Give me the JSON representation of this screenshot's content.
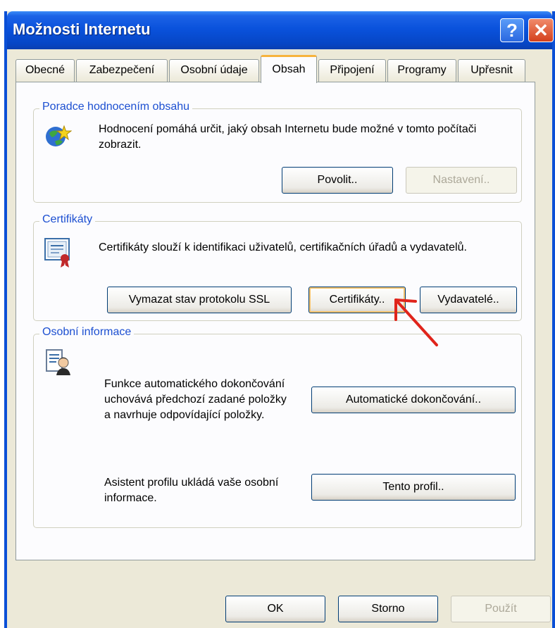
{
  "window": {
    "title": "Možnosti Internetu",
    "help_glyph": "?",
    "close_glyph": "✕"
  },
  "tabs": [
    {
      "label": "Obecné"
    },
    {
      "label": "Zabezpečení"
    },
    {
      "label": "Osobní údaje"
    },
    {
      "label": "Obsah",
      "active": true
    },
    {
      "label": "Připojení"
    },
    {
      "label": "Programy"
    },
    {
      "label": "Upřesnit"
    }
  ],
  "content_advisor": {
    "legend": "Poradce hodnocením obsahu",
    "description": "Hodnocení pomáhá určit, jaký obsah Internetu bude možné v tomto počítači zobrazit.",
    "enable_label": "Povolit..",
    "settings_label": "Nastavení.."
  },
  "certificates": {
    "legend": "Certifikáty",
    "description": "Certifikáty slouží k identifikaci uživatelů, certifikačních úřadů a vydavatelů.",
    "clear_ssl_label": "Vymazat stav protokolu SSL",
    "certificates_label": "Certifikáty..",
    "publishers_label": "Vydavatelé.."
  },
  "personal_info": {
    "legend": "Osobní informace",
    "autocomplete_description": "Funkce automatického dokončování uchovává předchozí zadané položky a navrhuje odpovídající položky.",
    "autocomplete_label": "Automatické dokončování..",
    "profile_description": "Asistent profilu ukládá vaše osobní informace.",
    "profile_label": "Tento profil.."
  },
  "footer": {
    "ok_label": "OK",
    "cancel_label": "Storno",
    "apply_label": "Použít"
  },
  "colors": {
    "title_bar": "#0a52dc",
    "group_legend": "#1c4fd1",
    "annotation_arrow": "#e0241b"
  }
}
